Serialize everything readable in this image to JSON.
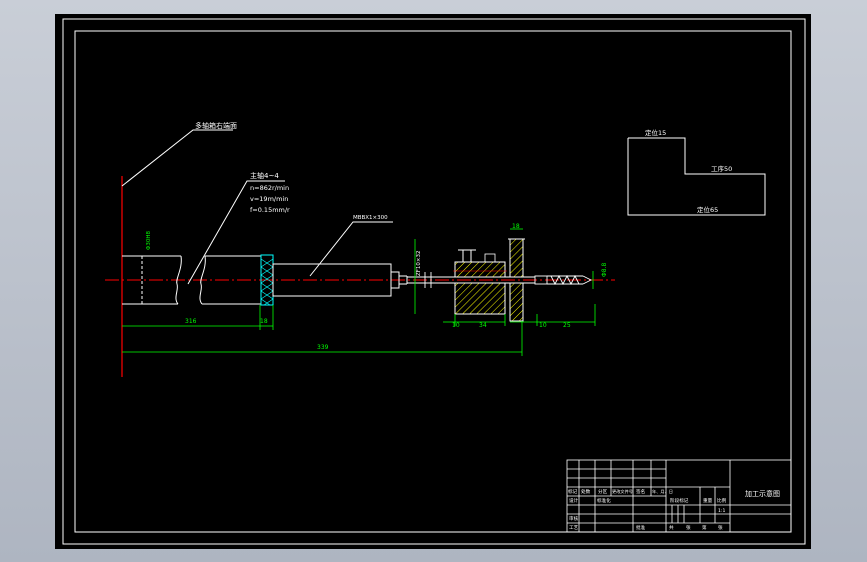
{
  "drawing": {
    "leader_texts": {
      "face_note": "多轴箱右端面",
      "process_note": "主轴4~4",
      "speed_n": "n=862r/min",
      "speed_v": "v=19m/min",
      "feed_f": "f=0.15mm/r",
      "spindle_label": "MBBX1×300",
      "bushing_label": "ZF10×32"
    },
    "dimensions": {
      "d_total": "339",
      "d_316": "316",
      "d_18a": "18",
      "d_10": "10",
      "d_34": "34",
      "d_10b": "10",
      "d_25": "25",
      "d_18": "18",
      "d_dia": "Φ8.8",
      "d_vert": "Φ30H8"
    },
    "part_sketch": {
      "ref_top": "定位15",
      "ref_work": "工序50",
      "ref_bottom": "定位65"
    },
    "title_block": {
      "drawing_title": "加工示意图",
      "headers": [
        "标记",
        "处数",
        "分区",
        "更改文件号",
        "签名",
        "年、月、日"
      ],
      "roles": [
        "设计",
        "审核",
        "工艺"
      ],
      "std_label": "标准化",
      "approve_label": "批准",
      "stage_label": "阶段标记",
      "weight_label": "重量",
      "scale_label": "比例",
      "scale_value": "1:1",
      "sheet_labels": [
        "共",
        "张",
        "第",
        "张"
      ]
    }
  },
  "colors": {
    "frame": "#ffffff",
    "geometry": "#ffffff",
    "dimensions": "#00ff00",
    "centerline": "#ff0000",
    "hatch": "#ffff00",
    "knurl": "#00ffff",
    "background": "#000000"
  }
}
